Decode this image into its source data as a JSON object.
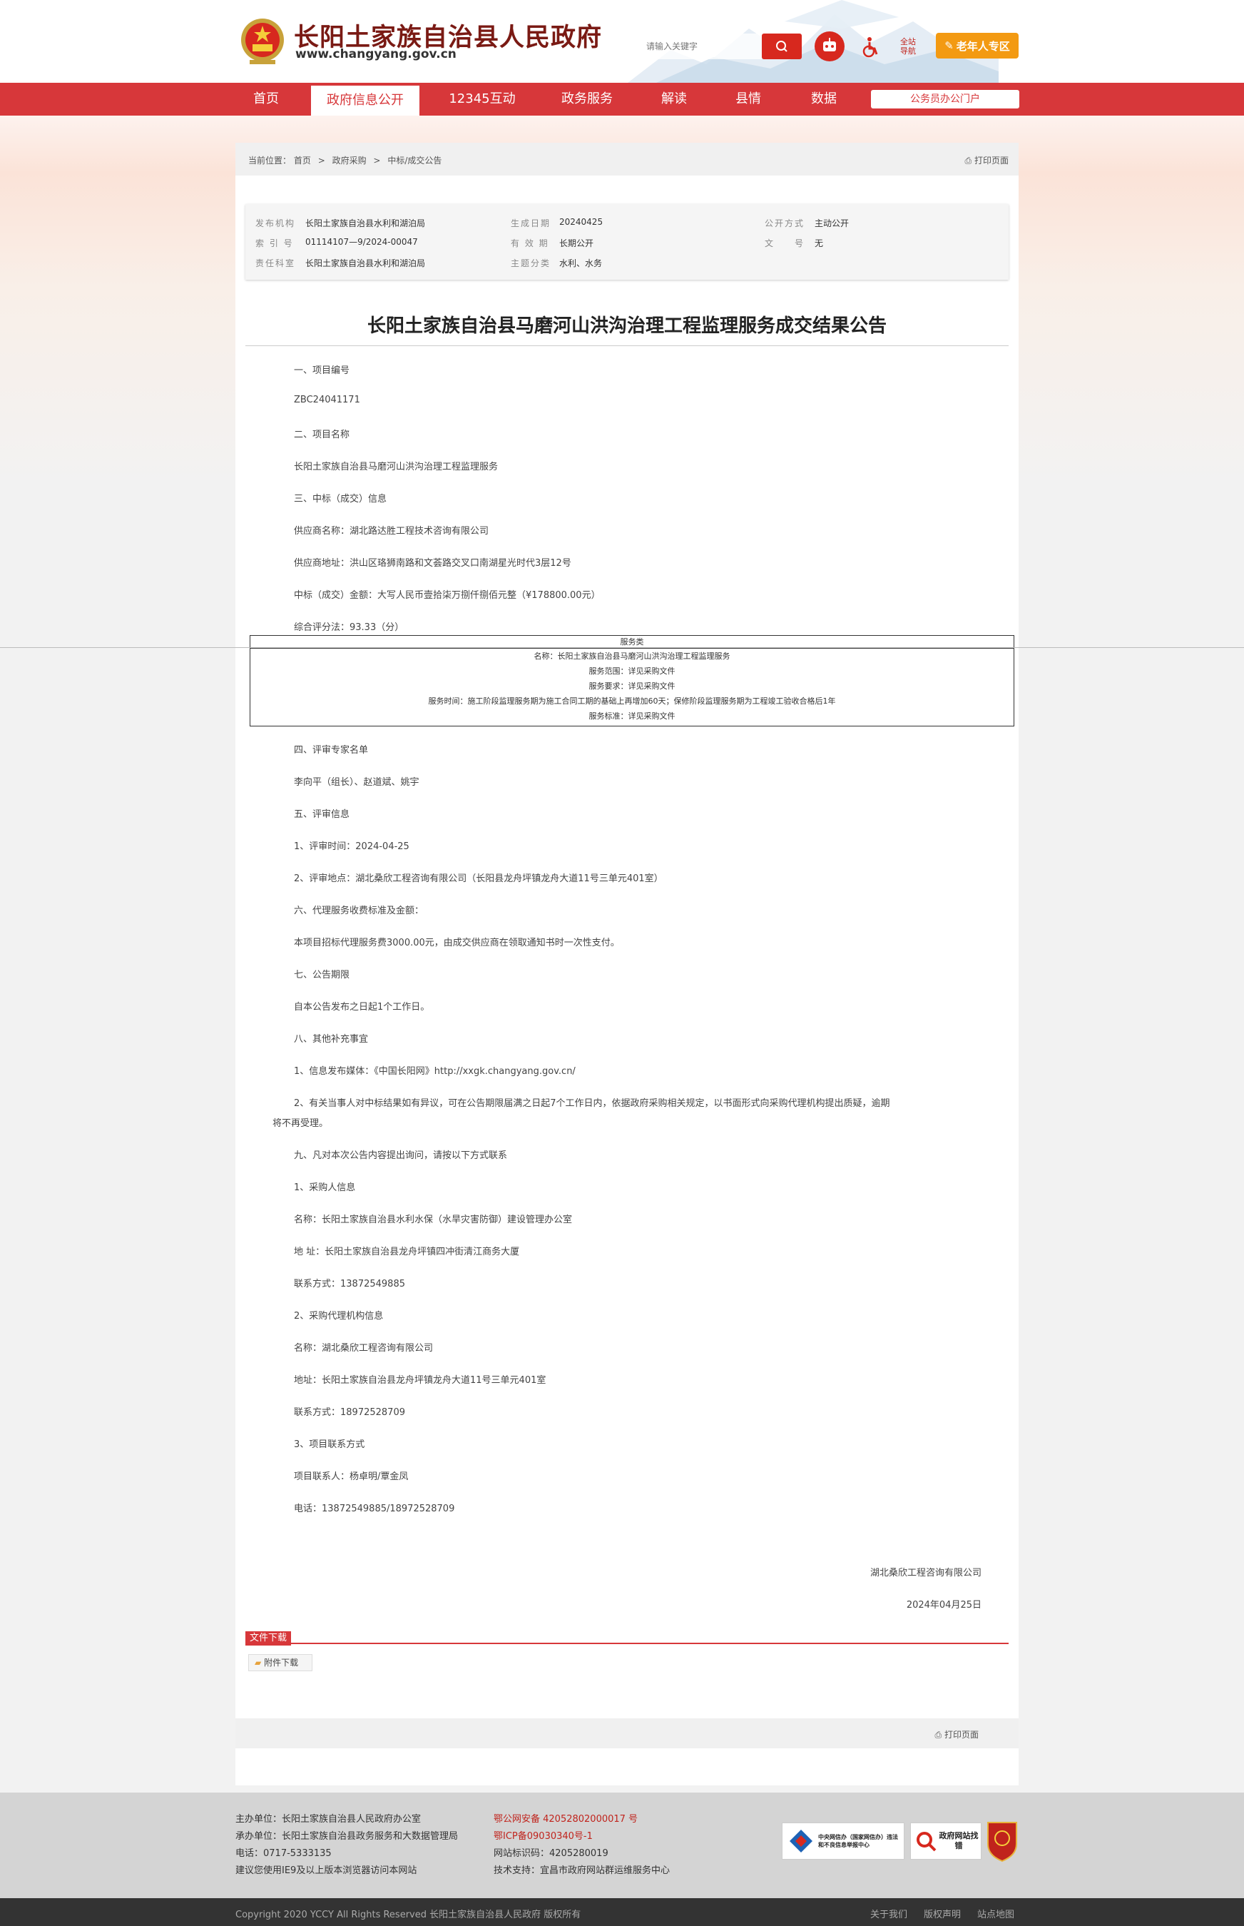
{
  "header": {
    "site_title": "长阳土家族自治县人民政府",
    "site_url": "www.changyang.gov.cn",
    "search_placeholder": "请输入关键字",
    "full_nav": "全站导航",
    "elder_label": "老年人专区",
    "portal_label": "公务员办公门户",
    "colors": {
      "primary_red": "#d7373a",
      "elder_orange": "#f39a12"
    }
  },
  "nav": {
    "items": [
      "首页",
      "政府信息公开",
      "12345互动",
      "政务服务",
      "解读",
      "县情",
      "数据"
    ],
    "active": "政府信息公开"
  },
  "breadcrumb": {
    "label": "当前位置：",
    "items": [
      "首页",
      "政府采购",
      "中标/成交公告"
    ],
    "sep": ">",
    "print": "打印页面"
  },
  "meta": {
    "publisher_label": "发布机构",
    "publisher": "长阳土家族自治县水利和湖泊局",
    "date_label": "生成日期",
    "date": "20240425",
    "mode_label": "公开方式",
    "mode": "主动公开",
    "index_label": "索 引 号",
    "index": "01114107—9/2024-00047",
    "validity_label": "有 效 期",
    "validity": "长期公开",
    "docno_label": "文　　号",
    "docno": "无",
    "dept_label": "责任科室",
    "dept": "长阳土家族自治县水利和湖泊局",
    "topic_label": "主题分类",
    "topic": "水利、水务"
  },
  "article": {
    "title": "长阳土家族自治县马磨河山洪沟治理工程监理服务成交结果公告",
    "s1": "一、项目编号",
    "s1_val": "ZBC24041171",
    "s2": "二、项目名称",
    "s2_val": "长阳土家族自治县马磨河山洪沟治理工程监理服务",
    "s3": "三、中标（成交）信息",
    "supplier": "供应商名称：湖北路达胜工程技术咨询有限公司",
    "supplier_addr": "供应商地址：洪山区珞狮南路和文荟路交叉口南湖星光时代3层12号",
    "amount": "中标（成交）金额：大写人民币壹拾柒万捌仟捌佰元整（¥178800.00元）",
    "score": "综合评分法：93.33（分）",
    "table_head": "服务类",
    "table_rows": [
      "名称：长阳土家族自治县马磨河山洪沟治理工程监理服务",
      "服务范围：详见采购文件",
      "服务要求：详见采购文件",
      "服务时间：施工阶段监理服务期为施工合同工期的基础上再增加60天；保修阶段监理服务期为工程竣工验收合格后1年",
      "服务标准：详见采购文件"
    ],
    "s4": "四、评审专家名单",
    "experts": "李向平（组长）、赵道斌、姚宇",
    "s5": "五、评审信息",
    "review_time": "1、评审时间：2024-04-25",
    "review_place": "2、评审地点：湖北桑欣工程咨询有限公司（长阳县龙舟坪镇龙舟大道11号三单元401室）",
    "s6": "六、代理服务收费标准及金额：",
    "fee": "本项目招标代理服务费3000.00元，由成交供应商在领取通知书时一次性支付。",
    "s7": "七、公告期限",
    "period": "自本公告发布之日起1个工作日。",
    "s8": "八、其他补充事宜",
    "media": "1、信息发布媒体：《中国长阳网》http://xxgk.changyang.gov.cn/",
    "objection_1": "2、有关当事人对中标结果如有异议，可在公告期限届满之日起7个工作日内，依据政府采购相关规定，以书面形式向采购代理机构提出质疑，逾期",
    "objection_2": "将不再受理。",
    "s9": "九、凡对本次公告内容提出询问，请按以下方式联系",
    "buyer_h": "1、采购人信息",
    "buyer_name": "名称：长阳土家族自治县水利水保（水旱灾害防御）建设管理办公室",
    "buyer_addr": "地 址：长阳土家族自治县龙舟坪镇四冲街清江商务大厦",
    "buyer_tel": "联系方式：13872549885",
    "agent_h": "2、采购代理机构信息",
    "agent_name": "名称：湖北桑欣工程咨询有限公司",
    "agent_addr": "地址：长阳土家族自治县龙舟坪镇龙舟大道11号三单元401室",
    "agent_tel": "联系方式：18972528709",
    "contact_h": "3、项目联系方式",
    "contact": "项目联系人：杨卓明/覃金凤",
    "contact_tel": "电话：13872549885/18972528709",
    "sign_org": "湖北桑欣工程咨询有限公司",
    "sign_date": "2024年04月25日"
  },
  "download": {
    "header": "文件下载",
    "attach": "附件下载",
    "print": "打印页面"
  },
  "footer": {
    "host": "主办单位：长阳土家族自治县人民政府办公室",
    "organizer": "承办单位：长阳土家族自治县政务服务和大数据管理局",
    "tel": "电话：0717-5333135",
    "browser": "建议您使用IE9及以上版本浏览器访问本网站",
    "police": "鄂公网安备 42052802000017 号",
    "icp": "鄂ICP备09030340号-1",
    "site_id": "网站标识码：4205280019",
    "tech": "技术支持：宜昌市政府网站群运维服务中心",
    "badge1": "中央网信办（国家网信办）违法和不良信息举报中心",
    "badge2": "政府网站找错",
    "copyright": "Copyright 2020 YCCY All Rights Reserved 长阳土家族自治县人民政府 版权所有",
    "about": "关于我们",
    "rights": "版权声明",
    "sitemap": "站点地图"
  }
}
